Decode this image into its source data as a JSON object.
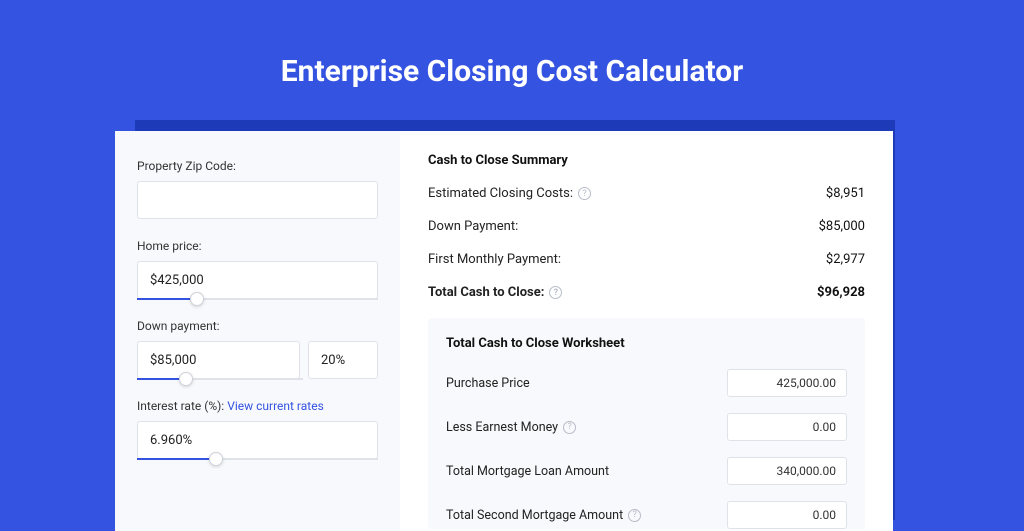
{
  "hero": {
    "title": "Enterprise Closing Cost Calculator"
  },
  "left": {
    "zip_label": "Property Zip Code:",
    "zip_value": "",
    "home_price_label": "Home price:",
    "home_price_value": "$425,000",
    "home_price_slider_pct": 22,
    "down_payment_label": "Down payment:",
    "down_payment_value": "$85,000",
    "down_payment_pct_value": "20%",
    "down_payment_slider_pct": 25,
    "interest_label_prefix": "Interest rate (%): ",
    "interest_link": "View current rates",
    "interest_value": "6.960%",
    "interest_slider_pct": 30
  },
  "summary": {
    "title": "Cash to Close Summary",
    "rows": [
      {
        "label": "Estimated Closing Costs:",
        "value": "$8,951",
        "help": true,
        "bold": false
      },
      {
        "label": "Down Payment:",
        "value": "$85,000",
        "help": false,
        "bold": false
      },
      {
        "label": "First Monthly Payment:",
        "value": "$2,977",
        "help": false,
        "bold": false
      },
      {
        "label": "Total Cash to Close:",
        "value": "$96,928",
        "help": true,
        "bold": true
      }
    ]
  },
  "worksheet": {
    "title": "Total Cash to Close Worksheet",
    "rows": [
      {
        "label": "Purchase Price",
        "value": "425,000.00",
        "help": false
      },
      {
        "label": "Less Earnest Money",
        "value": "0.00",
        "help": true
      },
      {
        "label": "Total Mortgage Loan Amount",
        "value": "340,000.00",
        "help": false
      },
      {
        "label": "Total Second Mortgage Amount",
        "value": "0.00",
        "help": true
      }
    ]
  }
}
